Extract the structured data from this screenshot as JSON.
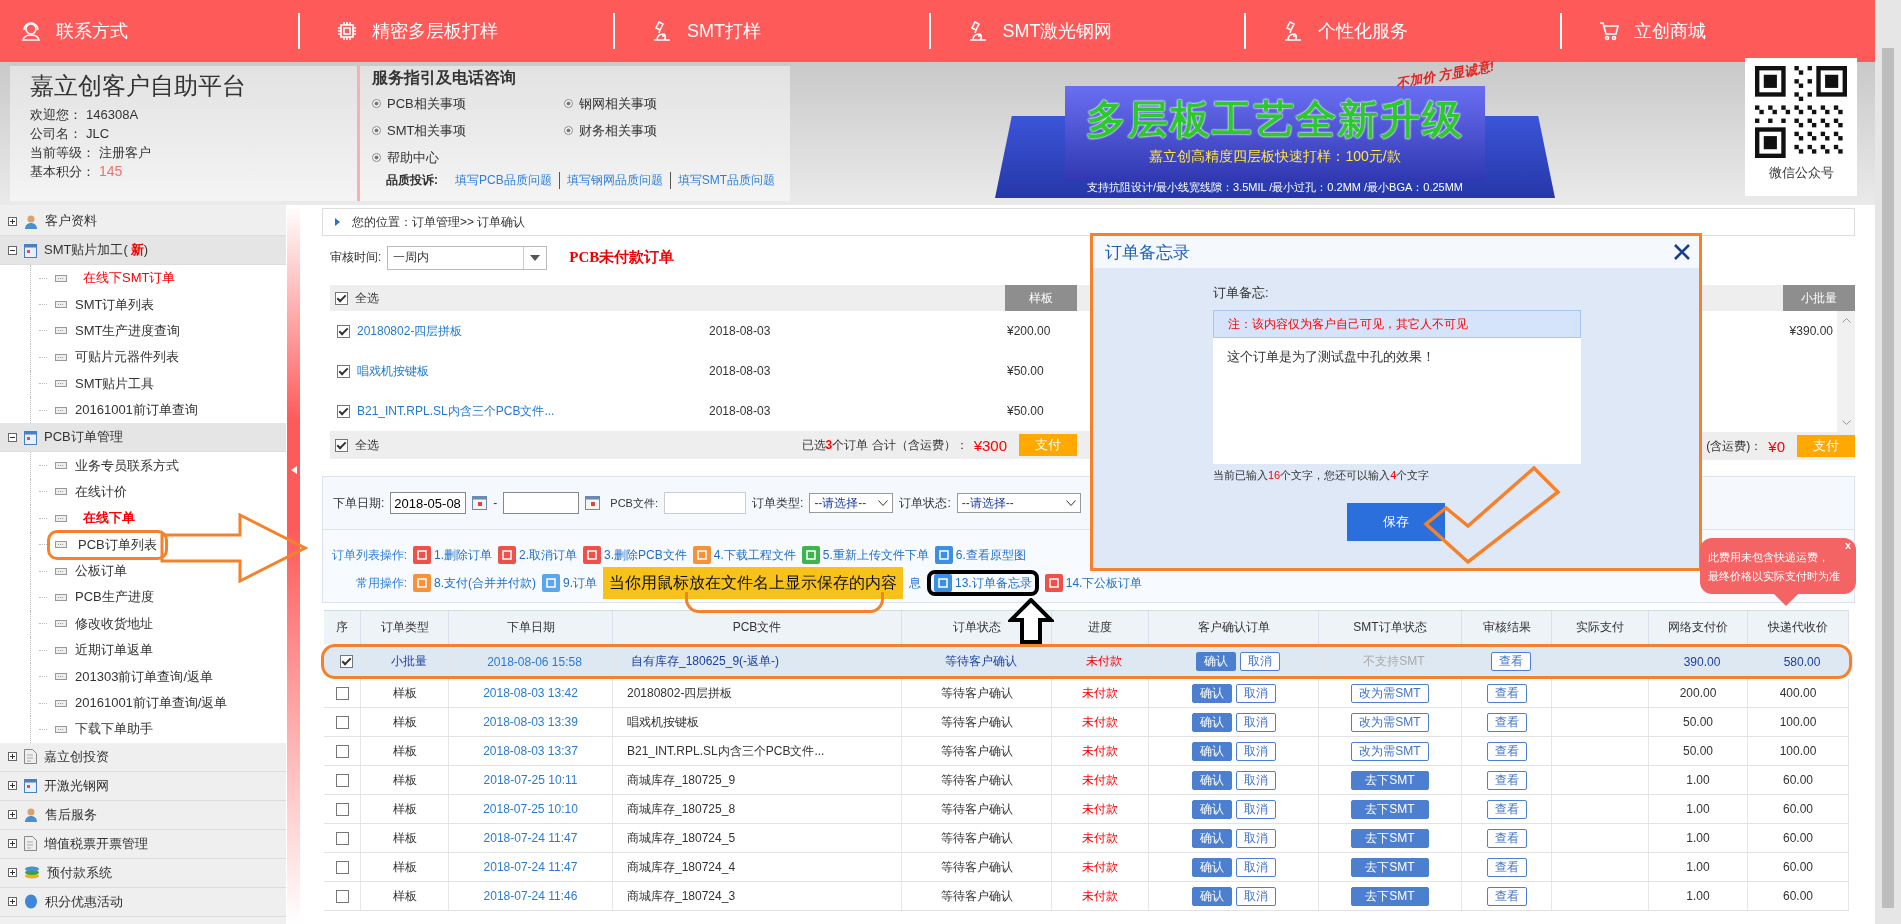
{
  "nav": [
    {
      "label": "联系方式"
    },
    {
      "label": "精密多层板打样"
    },
    {
      "label": "SMT打样"
    },
    {
      "label": "SMT激光钢网"
    },
    {
      "label": "个性化服务"
    },
    {
      "label": "立创商城"
    }
  ],
  "profile": {
    "title": "嘉立创客户自助平台",
    "fields": [
      {
        "label": "欢迎您：",
        "value": "146308A",
        "kind": "plain"
      },
      {
        "label": "公司名：",
        "value": "JLC",
        "kind": "plain"
      },
      {
        "label": "当前等级：",
        "value": "注册客户",
        "kind": "plain"
      },
      {
        "label": "基本积分：",
        "value": "145",
        "kind": "points"
      }
    ]
  },
  "service": {
    "title": "服务指引及电话咨询",
    "links": [
      "PCB相关事项",
      "钢网相关事项",
      "SMT相关事项",
      "财务相关事项",
      "帮助中心"
    ],
    "complaint_label": "品质投诉:",
    "complaint_links": [
      "填写PCB品质问题",
      "填写钢网品质问题",
      "填写SMT品质问题"
    ]
  },
  "banner": {
    "slogan": "不加价 方显诚意!",
    "headline": "多层板工艺全新升级",
    "subtitle": "嘉立创高精度四层板快速打样：100元/款",
    "specs": "支持抗阻设计/最小线宽线隙：3.5MIL  /最小过孔：0.2MM  /最小BGA：0.25MM"
  },
  "qr": {
    "caption": "微信公众号"
  },
  "sidebar": [
    {
      "label": "客户资料",
      "expanded": false
    },
    {
      "label": "SMT贴片加工(",
      "tag": "新",
      "label_end": ")",
      "expanded": true,
      "children": [
        {
          "label": "在线下SMT订单",
          "kind": "highlight",
          "highlighted": false
        },
        {
          "label": "SMT订单列表",
          "kind": "plain",
          "highlighted": false
        },
        {
          "label": "SMT生产进度查询",
          "kind": "plain",
          "highlighted": false
        },
        {
          "label": "可贴片元器件列表",
          "kind": "plain",
          "highlighted": false
        },
        {
          "label": "SMT贴片工具",
          "kind": "plain",
          "highlighted": false
        },
        {
          "label": "20161001前订单查询",
          "kind": "plain",
          "highlighted": false
        }
      ]
    },
    {
      "label": "PCB订单管理",
      "expanded": true,
      "children": [
        {
          "label": "业务专员联系方式",
          "kind": "plain",
          "highlighted": false
        },
        {
          "label": "在线计价",
          "kind": "plain",
          "highlighted": false
        },
        {
          "label": "在线下单",
          "kind": "strong",
          "highlighted": false
        },
        {
          "label": "PCB订单列表",
          "kind": "plain",
          "highlighted": true
        },
        {
          "label": "公板订单",
          "kind": "plain",
          "highlighted": false
        },
        {
          "label": "PCB生产进度",
          "kind": "plain",
          "highlighted": false
        },
        {
          "label": "修改收货地址",
          "kind": "plain",
          "highlighted": false
        },
        {
          "label": "近期订单返单",
          "kind": "plain",
          "highlighted": false
        },
        {
          "label": "201303前订单查询/返单",
          "kind": "plain",
          "highlighted": false
        },
        {
          "label": "20161001前订单查询/返单",
          "kind": "plain",
          "highlighted": false
        },
        {
          "label": "下载下单助手",
          "kind": "plain",
          "highlighted": false
        }
      ]
    },
    {
      "label": "嘉立创投资",
      "expanded": false
    },
    {
      "label": "开激光钢网",
      "expanded": false
    },
    {
      "label": "售后服务",
      "expanded": false
    },
    {
      "label": "增值税票开票管理",
      "expanded": false
    },
    {
      "label": "预付款系统",
      "expanded": false
    },
    {
      "label": "积分优惠活动",
      "expanded": false
    }
  ],
  "breadcrumb": "您的位置：订单管理>> 订单确认",
  "review_filter": {
    "label": "审核时间:",
    "value": "一周内",
    "title": "PCB未付款订单"
  },
  "sample_box": {
    "select_all": {
      "label": "全选",
      "checked": true
    },
    "type": "样板",
    "rows": [
      {
        "name": "20180802-四层拼板",
        "date": "2018-08-03",
        "price": "¥200.00",
        "checked": true
      },
      {
        "name": "唱戏机按键板",
        "date": "2018-08-03",
        "price": "¥50.00",
        "checked": true
      },
      {
        "name": "B21_INT.RPL.SL内含三个PCB文件...",
        "date": "2018-08-03",
        "price": "¥50.00",
        "checked": true
      }
    ],
    "footer_select_all": {
      "label": "全选",
      "checked": true
    },
    "summary_before": "已选",
    "selected_count": "3",
    "summary_after": "个订单  合计（含运费）：",
    "total": "¥300",
    "pay": "支付"
  },
  "batch_box": {
    "type": "小批量",
    "rows": [
      {
        "price": "¥390.00"
      }
    ],
    "summary_after": "(含运费)：",
    "total": "¥0",
    "pay": "支付"
  },
  "search": {
    "date_label": "下单日期:",
    "date_from": "2018-05-08",
    "date_separator": "-",
    "file_label": "PCB文件:",
    "type_label": "订单类型:",
    "type_value": "--请选择--",
    "status_label": "订单状态:",
    "status_value": "--请选择--"
  },
  "operations": [
    {
      "label": "订单列表操作:",
      "items": [
        {
          "text": "1.删除订单",
          "color": "#f0504a",
          "kind": "action",
          "highlighted": false
        },
        {
          "text": "2.取消订单",
          "color": "#f0504a",
          "kind": "action",
          "highlighted": false
        },
        {
          "text": "3.删除PCB文件",
          "color": "#f0504a",
          "kind": "action",
          "highlighted": false
        },
        {
          "text": "4.下载工程文件",
          "color": "#f5923a",
          "kind": "action",
          "highlighted": false
        },
        {
          "text": "5.重新上传文件下单",
          "color": "#3fb34f",
          "kind": "action",
          "highlighted": false
        },
        {
          "text": "6.查看原型图",
          "color": "#3d8fe0",
          "kind": "action",
          "highlighted": false
        }
      ]
    },
    {
      "label": "常用操作:",
      "items": [
        {
          "text": "8.支付(合并并付款)",
          "color": "#f5923a",
          "kind": "action",
          "highlighted": false
        },
        {
          "text": "9.订单",
          "color": "#5aa6e8",
          "kind": "action",
          "highlighted": false
        },
        {
          "text": "息",
          "kind": "fragment",
          "highlighted": false
        },
        {
          "text": "13.订单备忘录",
          "color": "#3d8fe0",
          "kind": "action",
          "highlighted": true
        },
        {
          "text": "14.下公板订单",
          "color": "#f0504a",
          "kind": "action",
          "highlighted": false
        }
      ]
    }
  ],
  "table": {
    "columns": [
      "序",
      "订单类型",
      "下单日期",
      "PCB文件",
      "订单状态",
      "进度",
      "客户确认订单",
      "SMT订单状态",
      "审核结果",
      "实际支付",
      "网络支付价",
      "快递代收价"
    ],
    "rows": [
      {
        "selected": true,
        "highlighted": true,
        "type": "小批量",
        "date": "2018-08-06 15:58",
        "file": "自有库存_180625_9(-返单-)",
        "status": "等待客户确认",
        "progress": "未付款",
        "confirm": "确认",
        "cancel": "取消",
        "smt": {
          "kind": "unsupported",
          "text": "不支持SMT"
        },
        "review": "查看",
        "net_price": "390.00",
        "courier_price": "580.00"
      },
      {
        "selected": false,
        "highlighted": false,
        "type": "样板",
        "date": "2018-08-03 13:42",
        "file": "20180802-四层拼板",
        "status": "等待客户确认",
        "progress": "未付款",
        "confirm": "确认",
        "cancel": "取消",
        "smt": {
          "kind": "convert",
          "text": "改为需SMT"
        },
        "review": "查看",
        "net_price": "200.00",
        "courier_price": "400.00"
      },
      {
        "selected": false,
        "highlighted": false,
        "type": "样板",
        "date": "2018-08-03 13:39",
        "file": "唱戏机按键板",
        "status": "等待客户确认",
        "progress": "未付款",
        "confirm": "确认",
        "cancel": "取消",
        "smt": {
          "kind": "convert",
          "text": "改为需SMT"
        },
        "review": "查看",
        "net_price": "50.00",
        "courier_price": "100.00"
      },
      {
        "selected": false,
        "highlighted": false,
        "type": "样板",
        "date": "2018-08-03 13:37",
        "file": "B21_INT.RPL.SL内含三个PCB文件...",
        "status": "等待客户确认",
        "progress": "未付款",
        "confirm": "确认",
        "cancel": "取消",
        "smt": {
          "kind": "convert",
          "text": "改为需SMT"
        },
        "review": "查看",
        "net_price": "50.00",
        "courier_price": "100.00"
      },
      {
        "selected": false,
        "highlighted": false,
        "type": "样板",
        "date": "2018-07-25 10:11",
        "file": "商城库存_180725_9",
        "status": "等待客户确认",
        "progress": "未付款",
        "confirm": "确认",
        "cancel": "取消",
        "smt": {
          "kind": "order",
          "text": "去下SMT"
        },
        "review": "查看",
        "net_price": "1.00",
        "courier_price": "60.00"
      },
      {
        "selected": false,
        "highlighted": false,
        "type": "样板",
        "date": "2018-07-25 10:10",
        "file": "商城库存_180725_8",
        "status": "等待客户确认",
        "progress": "未付款",
        "confirm": "确认",
        "cancel": "取消",
        "smt": {
          "kind": "order",
          "text": "去下SMT"
        },
        "review": "查看",
        "net_price": "1.00",
        "courier_price": "60.00"
      },
      {
        "selected": false,
        "highlighted": false,
        "type": "样板",
        "date": "2018-07-24 11:47",
        "file": "商城库存_180724_5",
        "status": "等待客户确认",
        "progress": "未付款",
        "confirm": "确认",
        "cancel": "取消",
        "smt": {
          "kind": "order",
          "text": "去下SMT"
        },
        "review": "查看",
        "net_price": "1.00",
        "courier_price": "60.00"
      },
      {
        "selected": false,
        "highlighted": false,
        "type": "样板",
        "date": "2018-07-24 11:47",
        "file": "商城库存_180724_4",
        "status": "等待客户确认",
        "progress": "未付款",
        "confirm": "确认",
        "cancel": "取消",
        "smt": {
          "kind": "order",
          "text": "去下SMT"
        },
        "review": "查看",
        "net_price": "1.00",
        "courier_price": "60.00"
      },
      {
        "selected": false,
        "highlighted": false,
        "type": "样板",
        "date": "2018-07-24 11:46",
        "file": "商城库存_180724_3",
        "status": "等待客户确认",
        "progress": "未付款",
        "confirm": "确认",
        "cancel": "取消",
        "smt": {
          "kind": "order",
          "text": "去下SMT"
        },
        "review": "查看",
        "net_price": "1.00",
        "courier_price": "60.00"
      }
    ]
  },
  "memo_dialog": {
    "title": "订单备忘录",
    "field_label": "订单备忘:",
    "notice": "注：该内容仅为客户自己可见，其它人不可见",
    "value": "这个订单是为了测试盘中孔的效果！",
    "counter_before": "当前已输入",
    "typed": "16",
    "counter_middle": "个文字，您还可以输入",
    "remaining": "4",
    "counter_after": "个文字",
    "save": "保存"
  },
  "fee_tooltip": {
    "lines": [
      "此费用未包含快递运费，",
      "最终价格以实际支付时为准"
    ],
    "close": "x"
  },
  "annotations": {
    "callout": "当你用鼠标放在文件名上显示保存的内容"
  }
}
